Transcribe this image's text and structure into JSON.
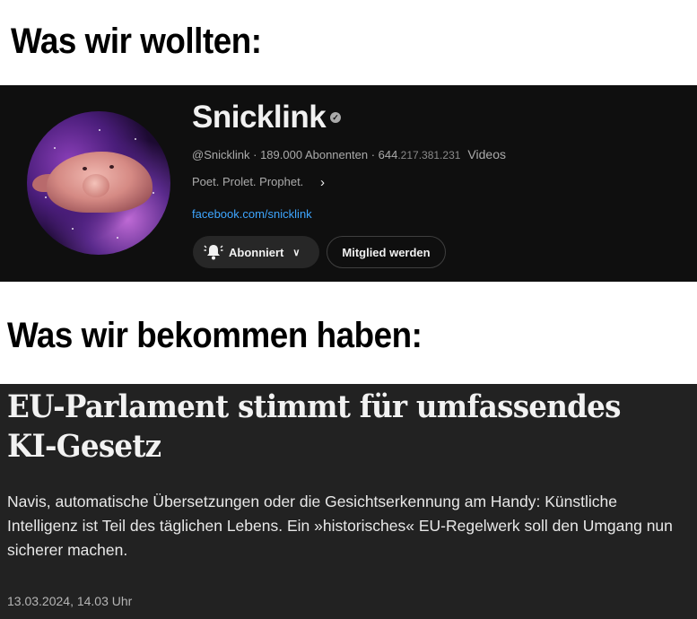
{
  "meme": {
    "heading_top": "Was wir wollten:",
    "heading_bottom": "Was wir bekommen haben:"
  },
  "channel": {
    "name": "Snicklink",
    "verified_icon": "check-circle-icon",
    "handle": "@Snicklink",
    "sep1": " · ",
    "subscribers": "189.000 Abonnenten",
    "sep2": " · ",
    "videos_count_a": "644",
    "videos_count_b": ".217.381.231",
    "videos_label": "Videos",
    "tagline": "Poet. Prolet. Prophet.",
    "link": "facebook.com/snicklink",
    "subscribe_button": "Abonniert",
    "member_button": "Mitglied werden",
    "colors": {
      "background": "#0f0f0f",
      "link": "#3ea6ff",
      "button": "#272727"
    }
  },
  "article": {
    "title": "EU-Parlament stimmt für umfassendes KI-Gesetz",
    "lead": "Navis, automatische Übersetzungen oder die Gesichtserkennung am Handy: Künstliche Intelligenz ist Teil des täglichen Lebens. Ein »historisches« EU-Regelwerk soll den Umgang nun sicherer machen.",
    "date": "13.03.2024, 14.03 Uhr",
    "colors": {
      "background": "#222222"
    }
  }
}
